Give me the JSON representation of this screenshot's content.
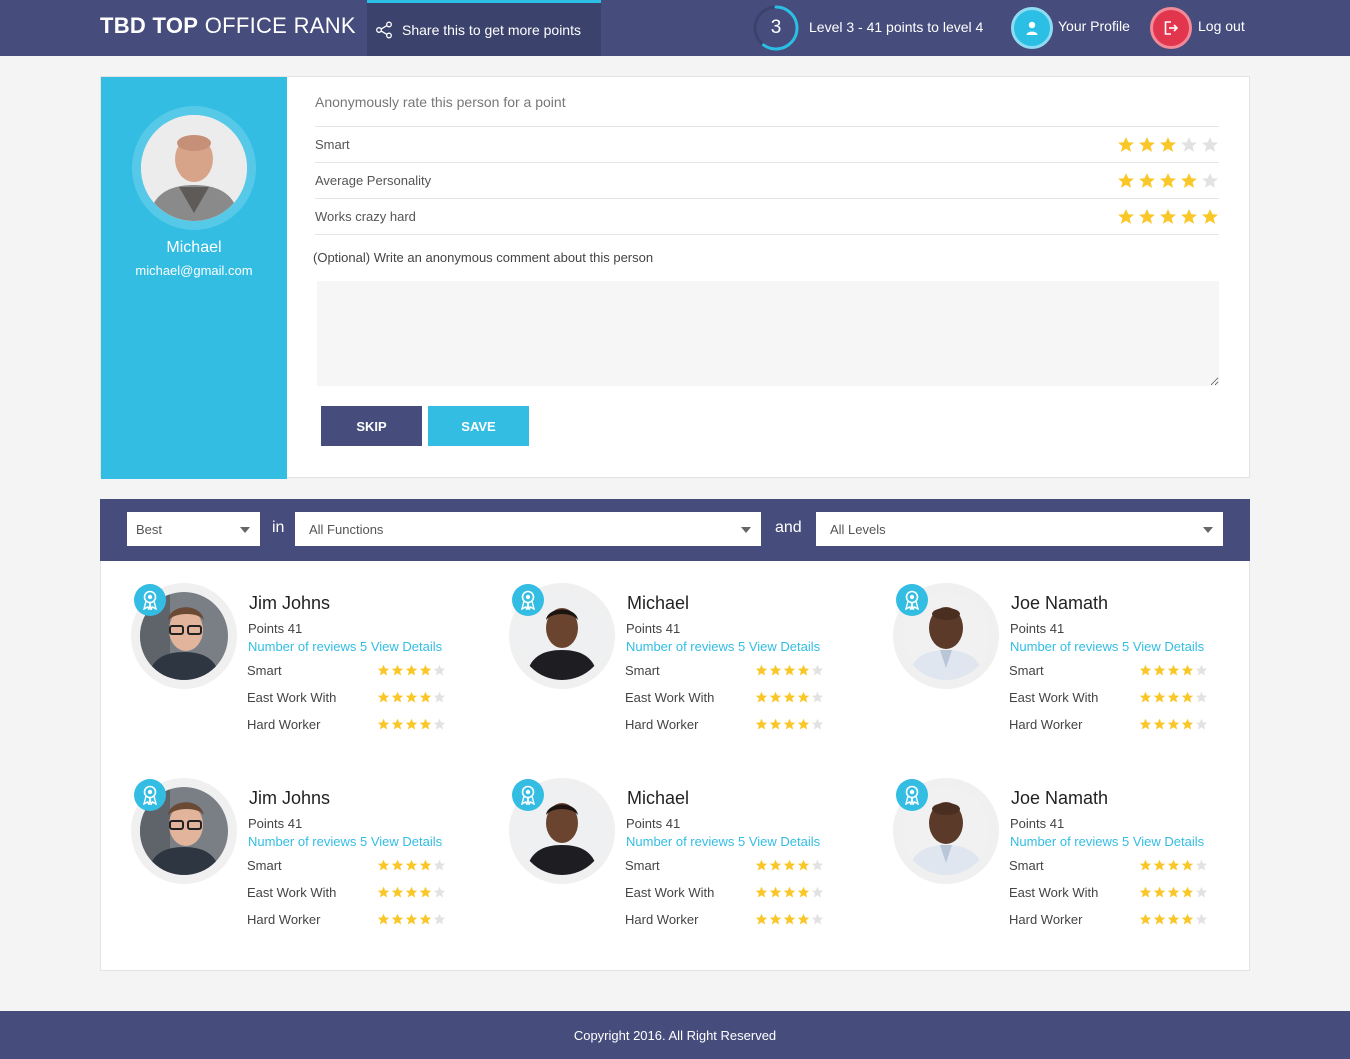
{
  "header": {
    "brand_bold": "TBD TOP",
    "brand_light": "OFFICE RANK",
    "share_label": "Share this to get more points",
    "level_number": "3",
    "level_text": "Level 3 - 41 points to level 4",
    "level_progress": 0.6,
    "profile_label": "Your Profile",
    "logout_label": "Log out"
  },
  "rating": {
    "person_name": "Michael",
    "person_email": "michael@gmail.com",
    "title": "Anonymously rate this person for a point",
    "criteria": [
      {
        "label": "Smart",
        "stars": 3
      },
      {
        "label": "Average Personality",
        "stars": 4
      },
      {
        "label": "Works crazy hard",
        "stars": 5
      }
    ],
    "comment_label": "(Optional) Write an anonymous comment about this person",
    "comment_value": "",
    "skip_label": "SKIP",
    "save_label": "SAVE"
  },
  "filters": {
    "sort_value": "Best",
    "in_label": "in",
    "function_value": "All Functions",
    "and_label": "and",
    "level_value": "All Levels"
  },
  "people": [
    {
      "name": "Jim Johns",
      "points": "Points 41",
      "reviews": "Number of reviews 5 View Details",
      "avatar": "glasses"
    },
    {
      "name": "Michael",
      "points": "Points 41",
      "reviews": "Number of reviews 5 View Details",
      "avatar": "dark"
    },
    {
      "name": "Joe Namath",
      "points": "Points 41",
      "reviews": "Number of reviews 5 View Details",
      "avatar": "bald"
    },
    {
      "name": "Jim Johns",
      "points": "Points 41",
      "reviews": "Number of reviews 5 View Details",
      "avatar": "glasses"
    },
    {
      "name": "Michael",
      "points": "Points 41",
      "reviews": "Number of reviews 5 View Details",
      "avatar": "dark"
    },
    {
      "name": "Joe Namath",
      "points": "Points 41",
      "reviews": "Number of reviews 5 View Details",
      "avatar": "bald"
    }
  ],
  "card_criteria": [
    {
      "label": "Smart",
      "stars": 4
    },
    {
      "label": "East Work With",
      "stars": 4
    },
    {
      "label": "Hard Worker",
      "stars": 4
    }
  ],
  "colors": {
    "navy": "#464d7c",
    "cyan": "#33bde3",
    "star_on": "#f9c728",
    "star_off": "#e2e2e2",
    "logout_red": "#e2364e"
  },
  "footer": {
    "copyright": "Copyright 2016. All Right Reserved"
  }
}
